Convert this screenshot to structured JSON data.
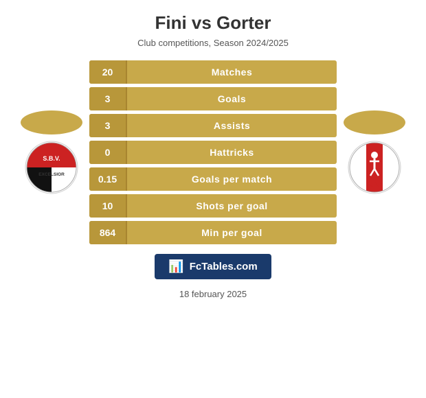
{
  "header": {
    "title": "Fini vs Gorter",
    "subtitle": "Club competitions, Season 2024/2025"
  },
  "stats": [
    {
      "value": "20",
      "label": "Matches"
    },
    {
      "value": "3",
      "label": "Goals"
    },
    {
      "value": "3",
      "label": "Assists"
    },
    {
      "value": "0",
      "label": "Hattricks"
    },
    {
      "value": "0.15",
      "label": "Goals per match"
    },
    {
      "value": "10",
      "label": "Shots per goal"
    },
    {
      "value": "864",
      "label": "Min per goal"
    }
  ],
  "badge": {
    "icon": "📊",
    "text": "FcTables.com"
  },
  "footer": {
    "date": "18 february 2025"
  },
  "colors": {
    "gold": "#c8a94a",
    "gold_dark": "#b8973a",
    "navy": "#1a3a6b"
  }
}
